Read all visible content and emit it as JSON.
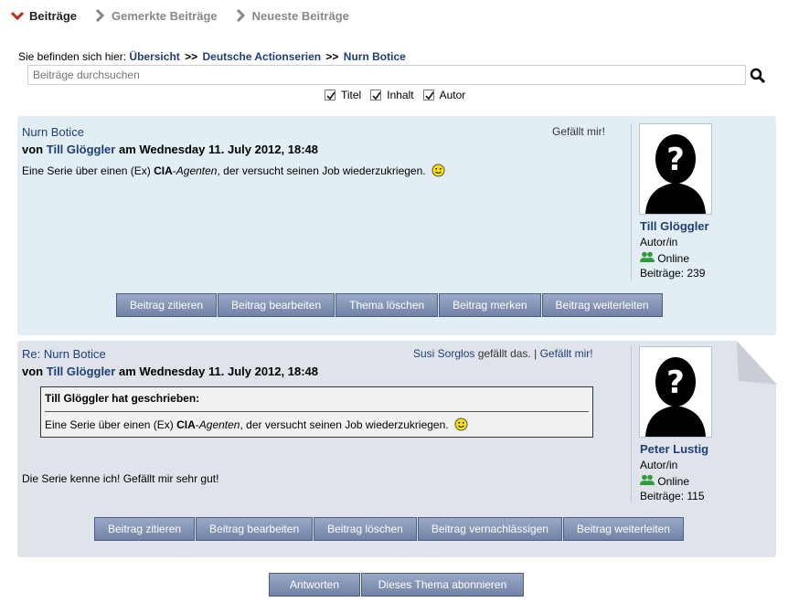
{
  "tabs": [
    {
      "label": "Beiträge",
      "icon": "chevron-down-icon",
      "active": true
    },
    {
      "label": "Gemerkte Beiträge",
      "icon": "chevron-right-icon"
    },
    {
      "label": "Neueste Beiträge",
      "icon": "chevron-right-icon"
    }
  ],
  "breadcrumb": {
    "prefix": "Sie befinden sich hier:",
    "items": [
      "Übersicht",
      "Deutsche Actionserien",
      "Nurn Botice"
    ],
    "separator": ">>"
  },
  "search": {
    "placeholder": "Beiträge durchsuchen",
    "icon": "search-icon"
  },
  "filters": [
    {
      "label": "Titel",
      "checked": true
    },
    {
      "label": "Inhalt",
      "checked": true
    },
    {
      "label": "Autor",
      "checked": true
    }
  ],
  "posts": [
    {
      "title": "Nurn Botice",
      "meta_prefix": "von",
      "author": "Till Glöggler",
      "meta_date": "am Wednesday 11. July 2012, 18:48",
      "text_before": "Eine Serie über einen (Ex)",
      "text_bold": "CIA",
      "text_dash": "-",
      "text_italic": "Agenten",
      "text_after": ", der versucht seinen Job wiederzukriegen.",
      "like_label": "Gefällt mir!",
      "user": {
        "name": "Till Glöggler",
        "role": "Autor/in",
        "status": "Online",
        "posts_label": "Beiträge: 239"
      },
      "buttons": [
        "Beitrag zitieren",
        "Beitrag bearbeiten",
        "Thema löschen",
        "Beitrag merken",
        "Beitrag weiterleiten"
      ]
    },
    {
      "title": "Re: Nurn Botice",
      "meta_prefix": "von",
      "author": "Till Glöggler",
      "meta_date": "am Wednesday 11. July 2012, 18:48",
      "liked_by": "Susi Sorglos",
      "liked_text": "gefällt das. |",
      "like_label": "Gefällt mir!",
      "quote": {
        "header": "Till Glöggler hat geschrieben:",
        "text_before": "Eine Serie über einen (Ex)",
        "text_bold": "CIA",
        "text_dash": "-",
        "text_italic": "Agenten",
        "text_after": ", der versucht seinen Job wiederzukriegen."
      },
      "text": "Die Serie kenne ich! Gefällt mir sehr gut!",
      "user": {
        "name": "Peter Lustig",
        "role": "Autor/in",
        "status": "Online",
        "posts_label": "Beiträge: 115"
      },
      "buttons": [
        "Beitrag zitieren",
        "Beitrag bearbeiten",
        "Beitrag löschen",
        "Beitrag vernachlässigen",
        "Beitrag weiterleiten"
      ]
    }
  ],
  "footer_buttons": [
    "Antworten",
    "Dieses Thema abonnieren"
  ],
  "colors": {
    "link": "#1f3f7a",
    "post1_bg": "#e2eef3",
    "post2_bg": "#dfe3ea",
    "button": "#7f90b3",
    "online": "#2e9b3b",
    "chevron_active": "#c0281e"
  }
}
